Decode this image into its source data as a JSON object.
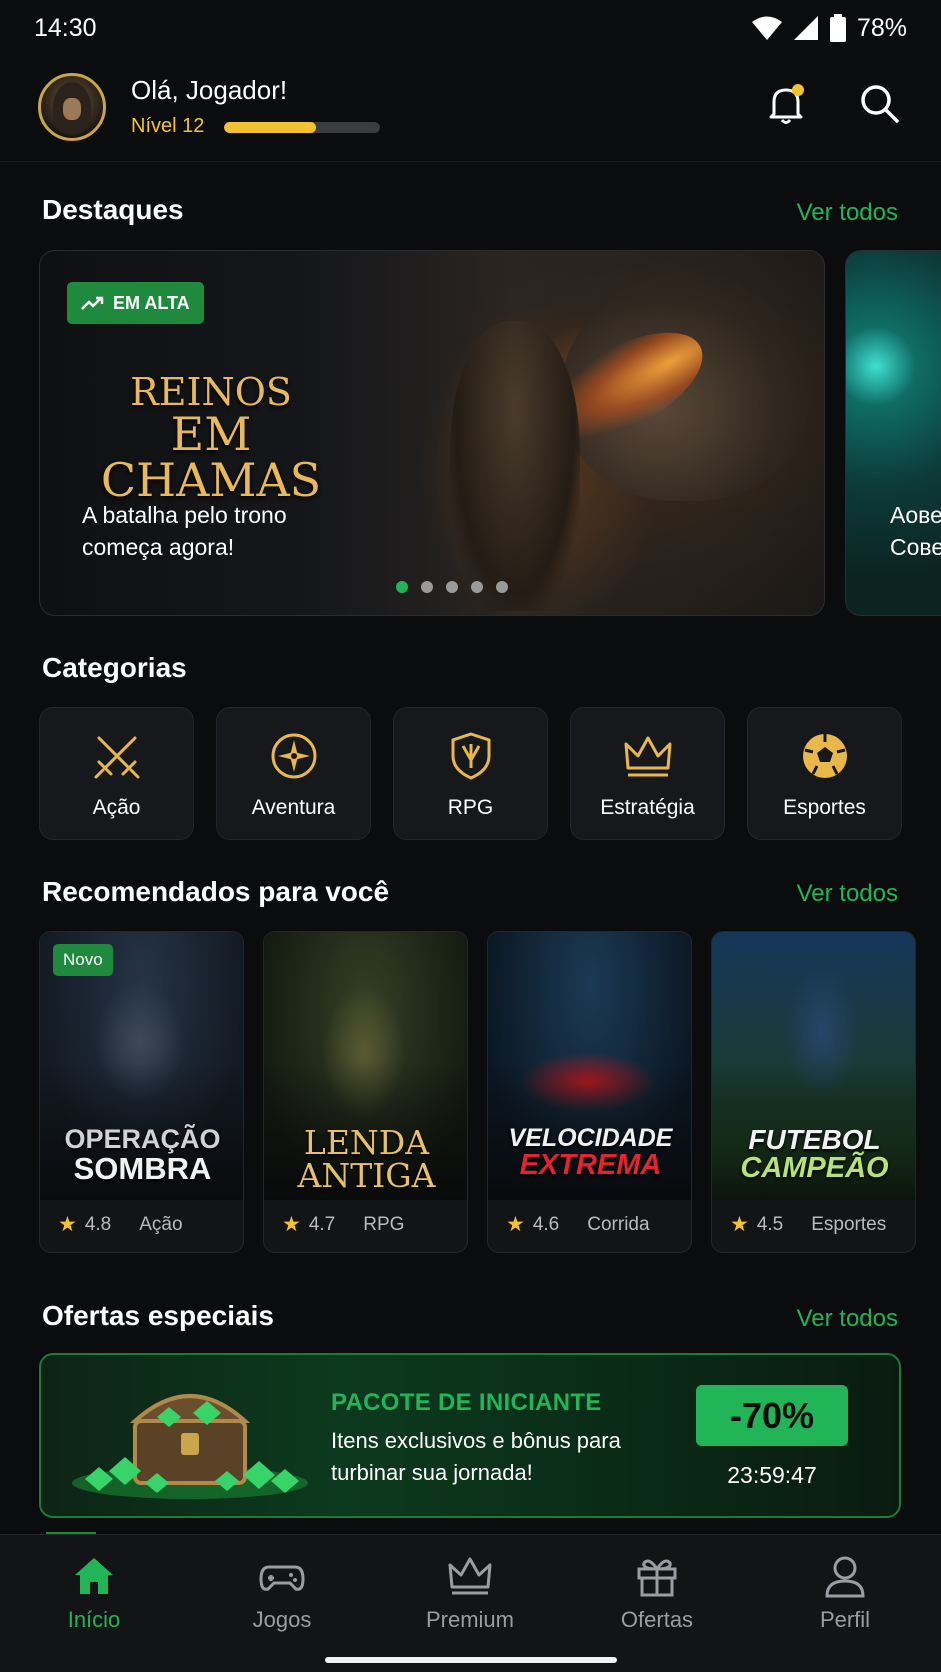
{
  "status_bar": {
    "time": "14:30",
    "battery": "78%"
  },
  "header": {
    "greeting": "Olá, Jogador!",
    "level_label": "Nível 12",
    "level_progress": 0.59,
    "notification_dot_color": "#f2c230"
  },
  "featured": {
    "section_title": "Destaques",
    "see_all": "Ver todos",
    "badge": "EM ALTA",
    "title_line1": "REINOS",
    "title_line2": "EM CHAMAS",
    "description": "A batalha pelo trono começa agora!",
    "slide_count": 5,
    "active_slide": 1,
    "peek_text": "Aове\nCове"
  },
  "categories": {
    "section_title": "Categorias",
    "items": [
      {
        "label": "Ação",
        "icon": "crossed-swords-icon"
      },
      {
        "label": "Aventura",
        "icon": "compass-icon"
      },
      {
        "label": "RPG",
        "icon": "shield-icon"
      },
      {
        "label": "Estratégia",
        "icon": "crown-icon"
      },
      {
        "label": "Esportes",
        "icon": "soccer-ball-icon"
      }
    ]
  },
  "recommended": {
    "section_title": "Recomendados para você",
    "see_all": "Ver todos",
    "new_badge": "Novo",
    "items": [
      {
        "title_a": "OPERAÇÃO",
        "title_b": "SOMBRA",
        "rating": "4.8",
        "genre": "Ação"
      },
      {
        "title_a": "LENDA",
        "title_b": "ANTIGA",
        "rating": "4.7",
        "genre": "RPG"
      },
      {
        "title_a": "VELOCIDADE",
        "title_b": "EXTREMA",
        "rating": "4.6",
        "genre": "Corrida"
      },
      {
        "title_a": "FUTEBOL",
        "title_b": "CAMPEÃO",
        "rating": "4.5",
        "genre": "Esportes"
      }
    ]
  },
  "offers": {
    "section_title": "Ofertas especiais",
    "see_all": "Ver todos",
    "title": "PACOTE DE INICIANTE",
    "description": "Itens exclusivos e bônus para turbinar sua jornada!",
    "discount": "-70%",
    "timer": "23:59:47"
  },
  "bottom_nav": {
    "items": [
      {
        "label": "Início",
        "icon": "home-icon",
        "active": true
      },
      {
        "label": "Jogos",
        "icon": "gamepad-icon",
        "active": false
      },
      {
        "label": "Premium",
        "icon": "crown-icon",
        "active": false
      },
      {
        "label": "Ofertas",
        "icon": "gift-icon",
        "active": false
      },
      {
        "label": "Perfil",
        "icon": "user-icon",
        "active": false
      }
    ]
  },
  "colors": {
    "accent": "#22b558",
    "gold": "#f2c230",
    "background": "#0b0c0e"
  }
}
